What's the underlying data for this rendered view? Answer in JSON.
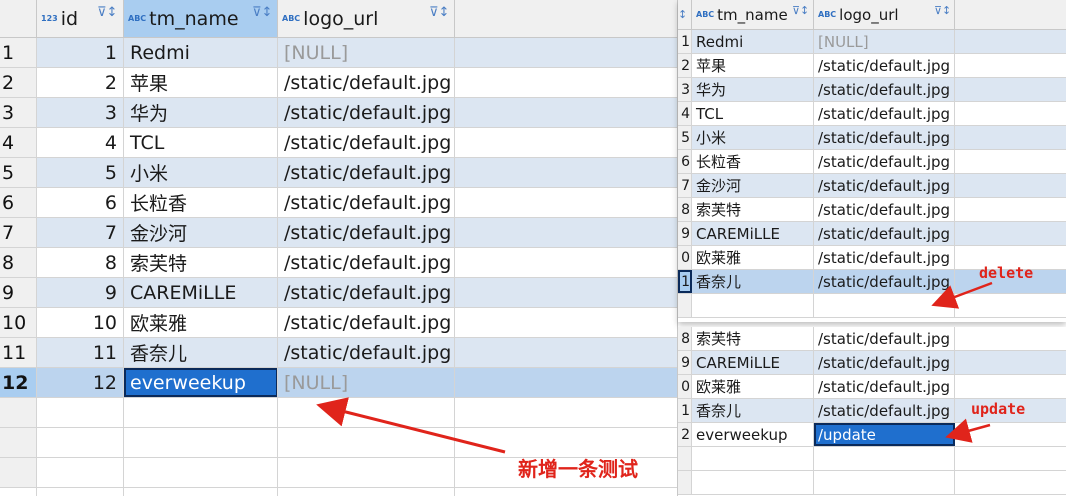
{
  "left_grid": {
    "columns": [
      {
        "type_icon": "123",
        "name": "id"
      },
      {
        "type_icon": "ABC",
        "name": "tm_name"
      },
      {
        "type_icon": "ABC",
        "name": "logo_url"
      }
    ],
    "rows": [
      {
        "rownum": "1",
        "id": "1",
        "tm_name": "Redmi",
        "logo_url": "[NULL]"
      },
      {
        "rownum": "2",
        "id": "2",
        "tm_name": "苹果",
        "logo_url": "/static/default.jpg"
      },
      {
        "rownum": "3",
        "id": "3",
        "tm_name": "华为",
        "logo_url": "/static/default.jpg"
      },
      {
        "rownum": "4",
        "id": "4",
        "tm_name": "TCL",
        "logo_url": "/static/default.jpg"
      },
      {
        "rownum": "5",
        "id": "5",
        "tm_name": "小米",
        "logo_url": "/static/default.jpg"
      },
      {
        "rownum": "6",
        "id": "6",
        "tm_name": "长粒香",
        "logo_url": "/static/default.jpg"
      },
      {
        "rownum": "7",
        "id": "7",
        "tm_name": "金沙河",
        "logo_url": "/static/default.jpg"
      },
      {
        "rownum": "8",
        "id": "8",
        "tm_name": "索芙特",
        "logo_url": "/static/default.jpg"
      },
      {
        "rownum": "9",
        "id": "9",
        "tm_name": "CAREMiLLE",
        "logo_url": "/static/default.jpg"
      },
      {
        "rownum": "10",
        "id": "10",
        "tm_name": "欧莱雅",
        "logo_url": "/static/default.jpg"
      },
      {
        "rownum": "11",
        "id": "11",
        "tm_name": "香奈儿",
        "logo_url": "/static/default.jpg"
      },
      {
        "rownum": "12",
        "id": "12",
        "tm_name": "everweekup",
        "logo_url": "[NULL]"
      }
    ]
  },
  "right_top_grid": {
    "columns": [
      {
        "type_icon": "ABC",
        "name": "tm_name"
      },
      {
        "type_icon": "ABC",
        "name": "logo_url"
      }
    ],
    "rows": [
      {
        "rownum": "1",
        "tm_name": "Redmi",
        "logo_url": "[NULL]"
      },
      {
        "rownum": "2",
        "tm_name": "苹果",
        "logo_url": "/static/default.jpg"
      },
      {
        "rownum": "3",
        "tm_name": "华为",
        "logo_url": "/static/default.jpg"
      },
      {
        "rownum": "4",
        "tm_name": "TCL",
        "logo_url": "/static/default.jpg"
      },
      {
        "rownum": "5",
        "tm_name": "小米",
        "logo_url": "/static/default.jpg"
      },
      {
        "rownum": "6",
        "tm_name": "长粒香",
        "logo_url": "/static/default.jpg"
      },
      {
        "rownum": "7",
        "tm_name": "金沙河",
        "logo_url": "/static/default.jpg"
      },
      {
        "rownum": "8",
        "tm_name": "索芙特",
        "logo_url": "/static/default.jpg"
      },
      {
        "rownum": "9",
        "tm_name": "CAREMiLLE",
        "logo_url": "/static/default.jpg"
      },
      {
        "rownum": "0",
        "tm_name": "欧莱雅",
        "logo_url": "/static/default.jpg"
      },
      {
        "rownum": "1",
        "tm_name": "香奈儿",
        "logo_url": "/static/default.jpg"
      }
    ]
  },
  "right_bottom_grid": {
    "rows": [
      {
        "rownum": "8",
        "tm_name": "索芙特",
        "logo_url": "/static/default.jpg"
      },
      {
        "rownum": "9",
        "tm_name": "CAREMiLLE",
        "logo_url": "/static/default.jpg"
      },
      {
        "rownum": "0",
        "tm_name": "欧莱雅",
        "logo_url": "/static/default.jpg"
      },
      {
        "rownum": "1",
        "tm_name": "香奈儿",
        "logo_url": "/static/default.jpg"
      },
      {
        "rownum": "2",
        "tm_name": "everweekup",
        "logo_url": "/update"
      }
    ]
  },
  "annotations": {
    "insert_label": "新增一条测试",
    "delete_label": "delete",
    "update_label": "update"
  },
  "colors": {
    "annotation_red": "#e0241b",
    "row_alt": "#dce6f2",
    "header_active": "#a9cdf0",
    "edit_cell": "#1f6fce"
  }
}
